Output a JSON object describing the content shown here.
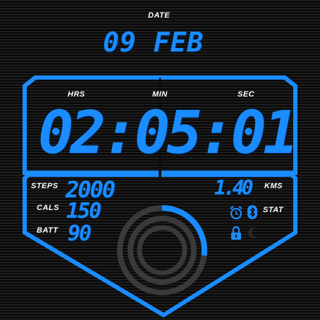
{
  "date": {
    "label": "DATE",
    "value": "09 FEB"
  },
  "time": {
    "hrs_label": "HRS",
    "min_label": "MIN",
    "sec_label": "SEC",
    "display": "02:05:01"
  },
  "stats": {
    "steps_label": "STEPS",
    "steps_value": "2000",
    "cals_label": "CALS",
    "cals_value": "150",
    "batt_label": "BATT",
    "batt_value": "90",
    "kms_label": "KMS",
    "kms_value": "1.40",
    "stat_label": "STAT"
  },
  "progress": {
    "steps_fraction": 0.27
  },
  "icons": [
    "alarm-clock-icon",
    "bluetooth-icon",
    "lock-icon",
    "moon-icon"
  ],
  "colors": {
    "accent": "#1a8cff",
    "ring": "#3a3a3a",
    "background": "#0b0b0b"
  }
}
